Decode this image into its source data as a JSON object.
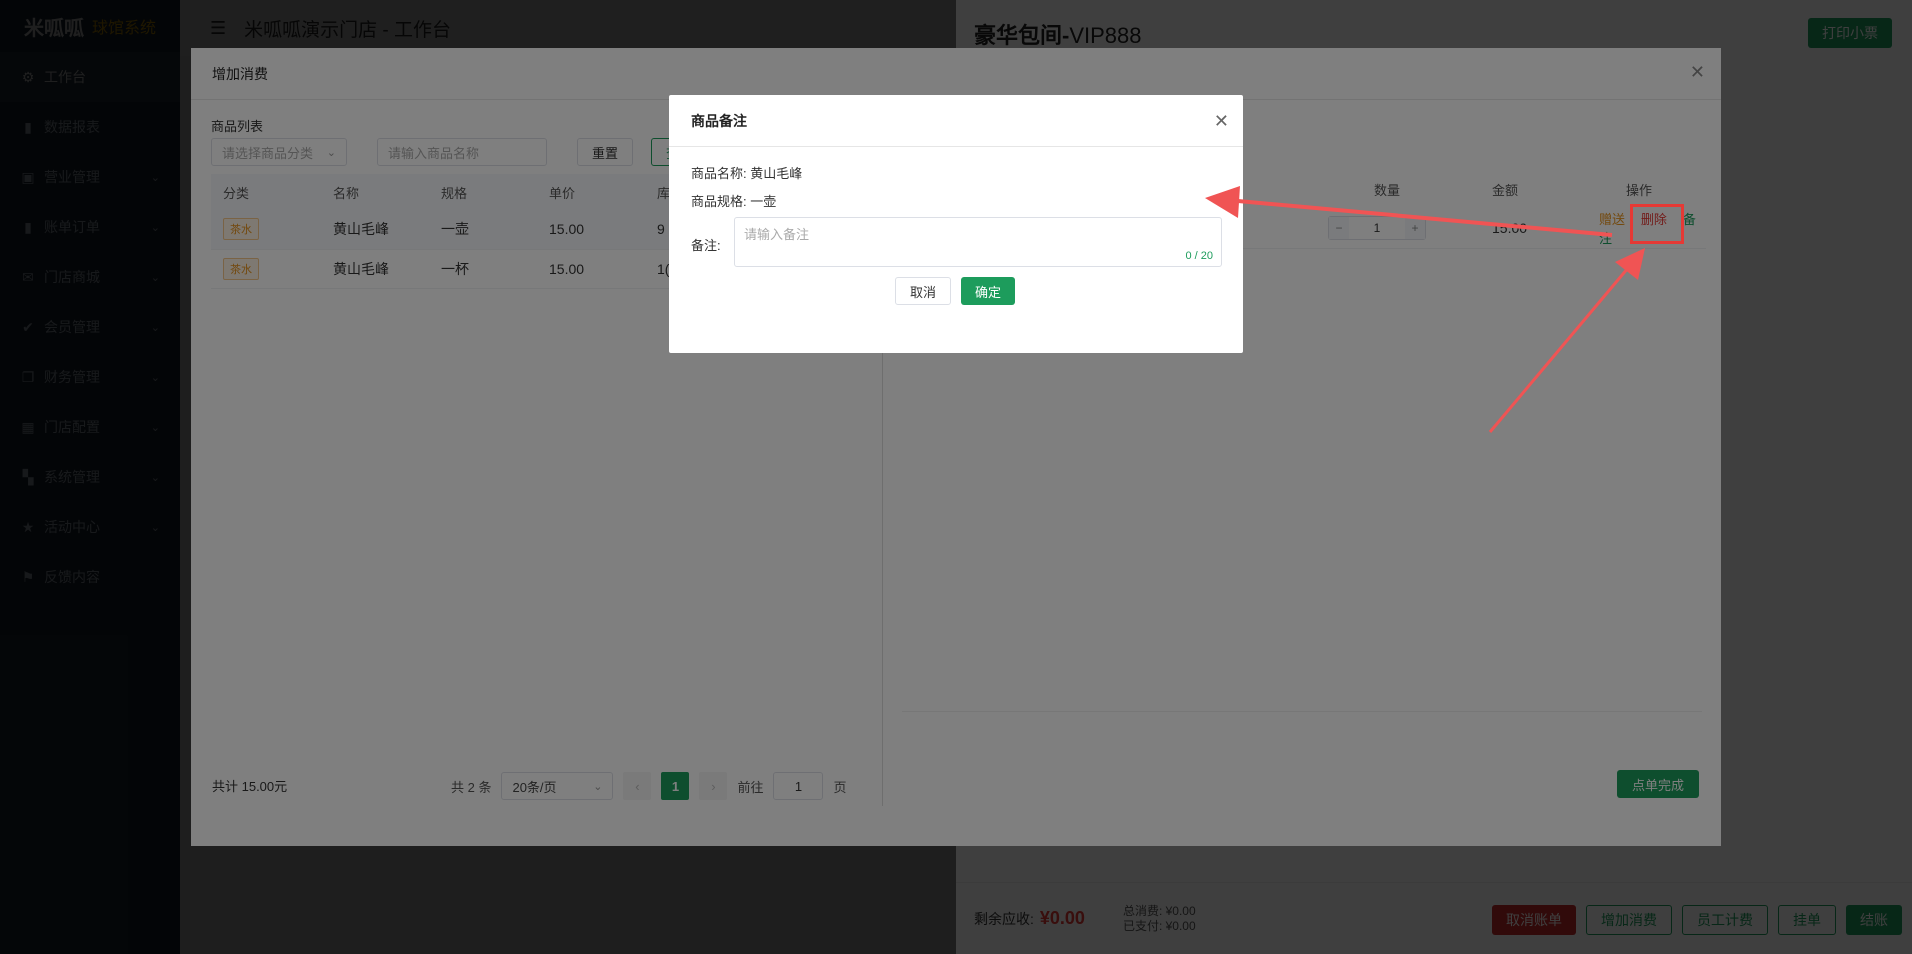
{
  "app": {
    "logo_mark": "米呱呱",
    "logo_system": "球馆系统",
    "store_title": "米呱呱演示门店 - 工作台"
  },
  "sidebar": {
    "items": [
      {
        "label": "工作台",
        "icon": "gear-icon",
        "active": true,
        "expandable": false
      },
      {
        "label": "数据报表",
        "icon": "bar-chart-icon",
        "active": false,
        "expandable": false
      },
      {
        "label": "营业管理",
        "icon": "cart-icon",
        "active": false,
        "expandable": true
      },
      {
        "label": "账单订单",
        "icon": "bar-chart-icon",
        "active": false,
        "expandable": true
      },
      {
        "label": "门店商城",
        "icon": "mail-icon",
        "active": false,
        "expandable": true
      },
      {
        "label": "会员管理",
        "icon": "check-icon",
        "active": false,
        "expandable": true
      },
      {
        "label": "财务管理",
        "icon": "copy-icon",
        "active": false,
        "expandable": true
      },
      {
        "label": "门店配置",
        "icon": "calendar-icon",
        "active": false,
        "expandable": true
      },
      {
        "label": "系统管理",
        "icon": "grid-icon",
        "active": false,
        "expandable": true
      },
      {
        "label": "活动中心",
        "icon": "star-icon",
        "active": false,
        "expandable": true
      },
      {
        "label": "反馈内容",
        "icon": "feedback-icon",
        "active": false,
        "expandable": false
      }
    ]
  },
  "drawer": {
    "room_name": "豪华包间-",
    "room_code": "VIP888",
    "print_label": "打印小票",
    "due_label": "剩余应收:",
    "due_value": "¥0.00",
    "total_spent": "总消费: ¥0.00",
    "paid": "已支付: ¥0.00",
    "buttons": [
      "取消账单",
      "增加消费",
      "员工计费",
      "挂单",
      "结账"
    ]
  },
  "add_dialog": {
    "title": "增加消费",
    "list_title": "商品列表",
    "category_placeholder": "请选择商品分类",
    "name_placeholder": "请输入商品名称",
    "reset_label": "重置",
    "query_label": "查",
    "columns": [
      "分类",
      "名称",
      "规格",
      "单价",
      "库"
    ],
    "rows": [
      {
        "category": "茶水",
        "name": "黄山毛峰",
        "spec": "一壶",
        "price": "15.00",
        "stock": "9"
      },
      {
        "category": "茶水",
        "name": "黄山毛峰",
        "spec": "一杯",
        "price": "15.00",
        "stock": "1("
      }
    ],
    "pager": {
      "total": "共 2 条",
      "page_size": "20条/页",
      "current": "1",
      "goto_label": "前往",
      "goto_value": "1",
      "page_suffix": "页"
    },
    "cart_columns": [
      "数量",
      "金额",
      "操作"
    ],
    "cart_row": {
      "qty": "1",
      "amount": "15.00",
      "gift": "赠送",
      "delete": "删除",
      "note": "备注"
    },
    "total_text": "共计 15.00元",
    "done_label": "点单完成"
  },
  "note_dialog": {
    "title": "商品备注",
    "name_label": "商品名称:",
    "name_value": "黄山毛峰",
    "spec_label": "商品规格:",
    "spec_value": "一壶",
    "note_label": "备注:",
    "note_placeholder": "请输入备注",
    "count": "0 / 20",
    "cancel_label": "取消",
    "confirm_label": "确定"
  },
  "colors": {
    "brand": "#1d9c5c",
    "danger": "#e53935",
    "warning": "#e6921c"
  }
}
